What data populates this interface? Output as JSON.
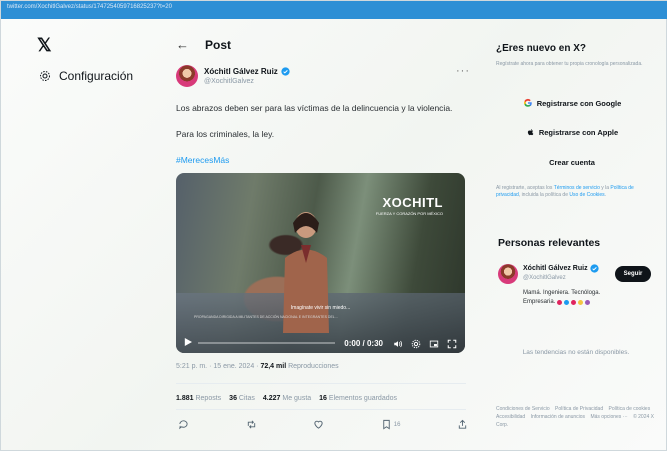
{
  "topbar": {
    "url": "twitter.com/XochitlGalvez/status/1747254059716825237?t=20"
  },
  "nav": {
    "logo": "𝕏",
    "settings_label": "Configuración"
  },
  "post": {
    "header_title": "Post",
    "author_name": "Xóchitl Gálvez Ruiz",
    "author_handle": "@XochitlGalvez",
    "text_line1": "Los abrazos deben ser para las víctimas de la delincuencia y la violencia.",
    "text_line2": "Para los criminales, la ley.",
    "hashtag": "#MerecesMás",
    "video": {
      "brand": "XOCHITL",
      "brand_sub": "FUERZA Y CORAZÓN POR MÉXICO",
      "caption": "Imagínate vivir sin miedo...",
      "fineprint": "PROPAGANDA DIRIGIDA A MILITANTES DE ACCIÓN NACIONAL E INTEGRANTES DEL...",
      "time": "0:00 / 0:30",
      "progress": 0.0
    },
    "timestamp": "5:21 p. m. · 15 ene. 2024 · ",
    "views_count": "72,4 mil",
    "views_label": "Reproducciones",
    "stats": {
      "reposts_count": "1.881",
      "reposts_label": "Reposts",
      "quotes_count": "36",
      "quotes_label": "Citas",
      "likes_count": "4.227",
      "likes_label": "Me gusta",
      "bookmarks_count": "16",
      "bookmarks_label": "Elementos guardados"
    },
    "actions": {
      "bookmark_count": "16"
    }
  },
  "sidebar_right": {
    "new_title": "¿Eres nuevo en X?",
    "new_sub": "Regístrate ahora para obtener tu propia cronología personalizada.",
    "google_label": "Registrarse con Google",
    "apple_label": "Registrarse con Apple",
    "create_label": "Crear cuenta",
    "terms_pre": "Al registrarte, aceptas los ",
    "terms_link1": "Términos de servicio",
    "terms_mid": " y la ",
    "terms_link2": "Política de privacidad",
    "terms_mid2": ", incluida la política de ",
    "terms_link3": "Uso de Cookies",
    "terms_end": ".",
    "relevant_title": "Personas relevantes",
    "relevant": {
      "name": "Xóchitl Gálvez Ruiz",
      "handle": "@XochitlGalvez",
      "bio1": "Mamá. Ingeniera. Tecnóloga.",
      "bio2": "Empresaria."
    },
    "follow_label": "Seguir",
    "trends_empty": "Las tendencias no están disponibles.",
    "footer": {
      "terms": "Condiciones de Servicio",
      "privacy": "Política de Privacidad",
      "cookies": "Política de cookies",
      "accessibility": "Accesibilidad",
      "ads": "Información de anuncios",
      "more": "Más opciones ···",
      "copyright": "© 2024 X Corp."
    }
  },
  "colors": {
    "accent": "#1d9bf0",
    "hearts": [
      "#e0245e",
      "#1d9bf0",
      "#e0245e",
      "#f4c542",
      "#9b59b6"
    ]
  }
}
